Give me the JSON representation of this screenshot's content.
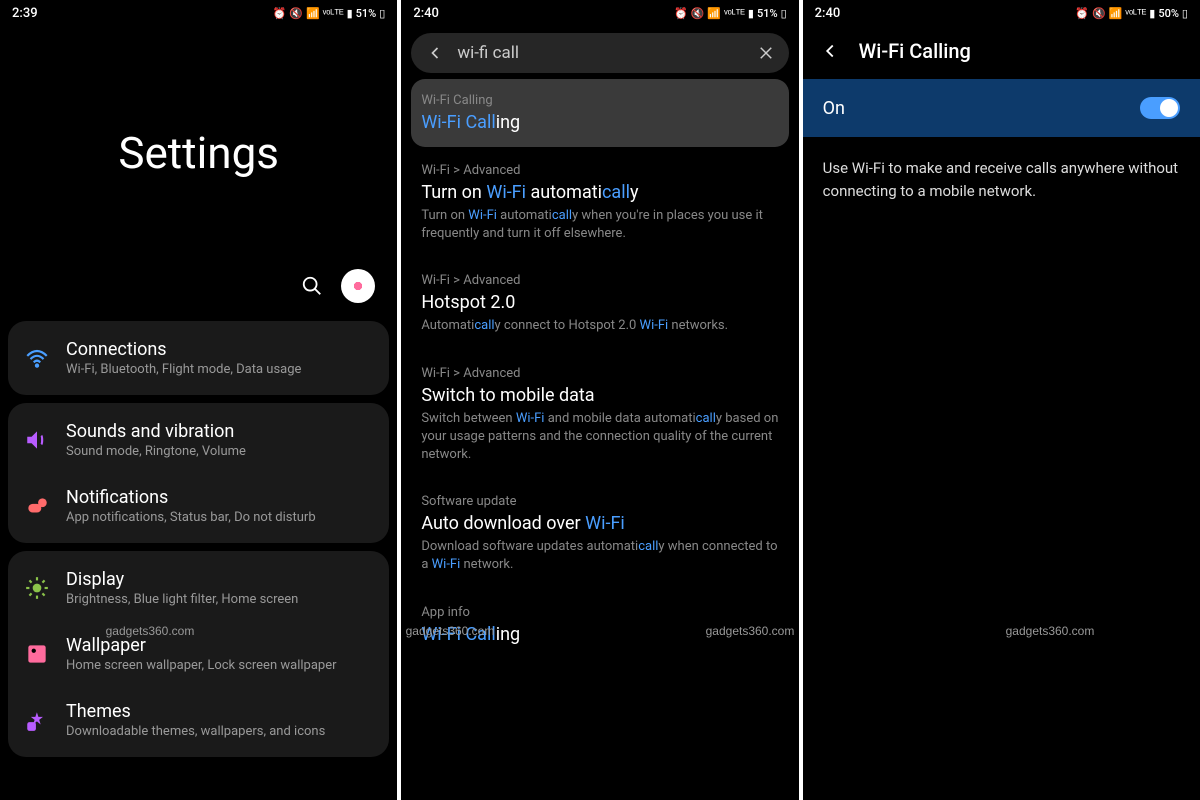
{
  "watermark": "gadgets360.com",
  "screen1": {
    "time": "2:39",
    "battery": "51%",
    "title": "Settings",
    "items": [
      {
        "title": "Connections",
        "sub": "Wi-Fi, Bluetooth, Flight mode, Data usage",
        "icon": "wifi",
        "color": "#4a9eff"
      },
      {
        "title": "Sounds and vibration",
        "sub": "Sound mode, Ringtone, Volume",
        "icon": "sound",
        "color": "#b85cff"
      },
      {
        "title": "Notifications",
        "sub": "App notifications, Status bar, Do not disturb",
        "icon": "notif",
        "color": "#ff6b6b"
      },
      {
        "title": "Display",
        "sub": "Brightness, Blue light filter, Home screen",
        "icon": "display",
        "color": "#8bc34a"
      },
      {
        "title": "Wallpaper",
        "sub": "Home screen wallpaper, Lock screen wallpaper",
        "icon": "wallpaper",
        "color": "#ff6b9d"
      },
      {
        "title": "Themes",
        "sub": "Downloadable themes, wallpapers, and icons",
        "icon": "themes",
        "color": "#b85cff"
      }
    ]
  },
  "screen2": {
    "time": "2:40",
    "battery": "51%",
    "query": "wi-fi call",
    "results": [
      {
        "breadcrumb": "Wi-Fi Calling",
        "title_pre": "Wi-Fi Call",
        "title_post": "ing",
        "desc": "",
        "highlighted": true,
        "title_hl": true
      },
      {
        "breadcrumb": "Wi-Fi > Advanced",
        "title": "Turn on Wi-Fi automatically",
        "desc": "Turn on Wi-Fi automatically when you're in places you use it frequently and turn it off elsewhere."
      },
      {
        "breadcrumb": "Wi-Fi > Advanced",
        "title": "Hotspot 2.0",
        "desc": "Automatically connect to Hotspot 2.0 Wi-Fi networks."
      },
      {
        "breadcrumb": "Wi-Fi > Advanced",
        "title": "Switch to mobile data",
        "desc": "Switch between Wi-Fi and mobile data automatically based on your usage patterns and the connection quality of the current network."
      },
      {
        "breadcrumb": "Software update",
        "title": "Auto download over Wi-Fi",
        "desc": "Download software updates automatically when connected to a Wi-Fi network."
      },
      {
        "breadcrumb": "App info",
        "title_pre": "Wi-Fi Call",
        "title_post": "ing",
        "desc": "",
        "title_hl": true
      }
    ]
  },
  "screen3": {
    "time": "2:40",
    "battery": "50%",
    "title": "Wi-Fi Calling",
    "toggle_label": "On",
    "toggle_on": true,
    "description": "Use Wi-Fi to make and receive calls anywhere without connecting to a mobile network."
  }
}
